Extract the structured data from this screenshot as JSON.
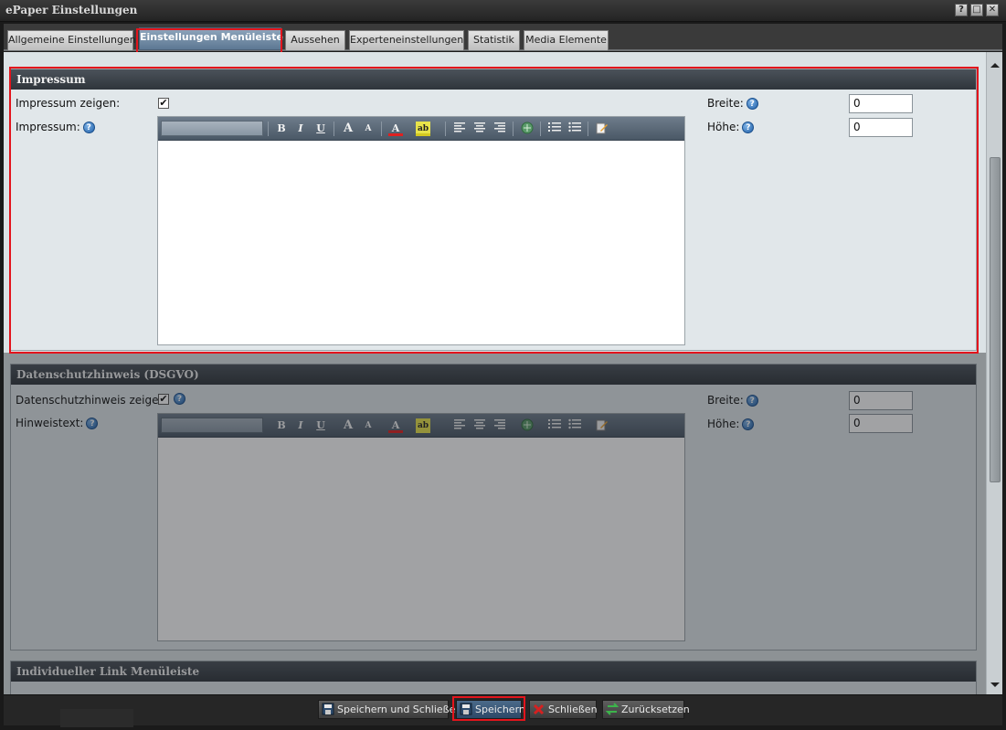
{
  "window": {
    "title": "ePaper Einstellungen",
    "help_glyph": "?",
    "max_glyph": "□",
    "close_glyph": "✕"
  },
  "tabs": [
    {
      "label": "Allgemeine Einstellungen"
    },
    {
      "label": "Einstellungen Menüleiste"
    },
    {
      "label": "Aussehen"
    },
    {
      "label": "Experteneinstellungen"
    },
    {
      "label": "Statistik"
    },
    {
      "label": "Media Elemente"
    }
  ],
  "active_tab_index": 1,
  "impressum": {
    "header": "Impressum",
    "show_label": "Impressum zeigen:",
    "show_checked": true,
    "content_label": "Impressum:",
    "breite_label": "Breite:",
    "breite_value": "0",
    "hoehe_label": "Höhe:",
    "hoehe_value": "0"
  },
  "datenschutz": {
    "header": "Datenschutzhinweis (DSGVO)",
    "show_label": "Datenschutzhinweis zeigen:",
    "show_checked": true,
    "content_label": "Hinweistext:",
    "breite_label": "Breite:",
    "breite_value": "0",
    "hoehe_label": "Höhe:",
    "hoehe_value": "0"
  },
  "custom_link": {
    "header": "Individueller Link Menüleiste"
  },
  "editor_toolbar": {
    "bold": "B",
    "italic": "I",
    "underline": "U",
    "grow": "A",
    "shrink": "A",
    "font_color": "A",
    "highlight": "ab"
  },
  "buttons": {
    "save_close": "Speichern und Schließen",
    "save": "Speichern",
    "close": "Schließen",
    "reset": "Zurücksetzen"
  },
  "help_glyph": "?",
  "check_glyph": "✔",
  "colors": {
    "highlight": "#e3141c",
    "active_tab": "#6f89a4",
    "section_header": "#3a4148"
  }
}
